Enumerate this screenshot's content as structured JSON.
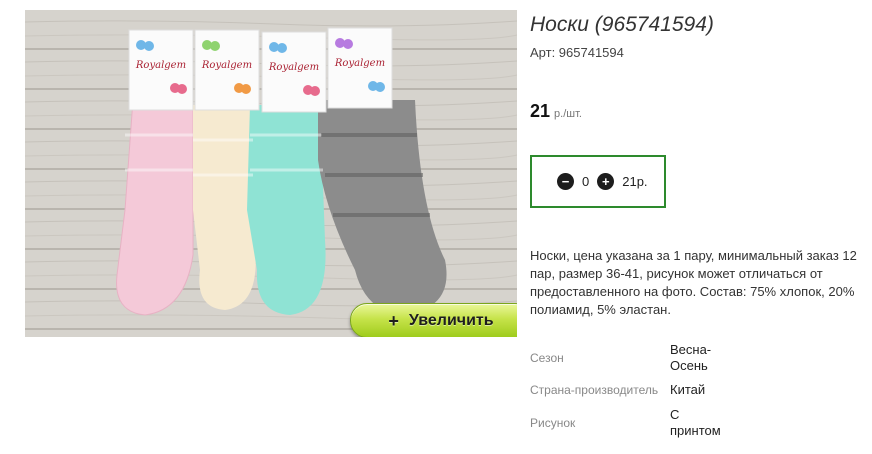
{
  "product": {
    "title": "Носки (965741594)",
    "sku": "Арт: 965741594",
    "price": "21",
    "price_unit": "р./шт.",
    "description": "Носки, цена указана за 1 пару, минимальный заказ 12 пар, размер 36-41, рисунок может отличаться от предоставленного на фото. Состав: 75% хлопок, 20% полиамид, 5% эластан."
  },
  "image": {
    "brand": "Royalgem",
    "zoom_label": "Увеличить",
    "zoom_icon": "+",
    "sock_colors": [
      "#f4c9d8",
      "#f6ead0",
      "#8fe3d4",
      "#8c8c8c"
    ]
  },
  "cart": {
    "minus_icon": "−",
    "plus_icon": "+",
    "quantity": "0",
    "total": "21р."
  },
  "attributes": [
    {
      "key": "Сезон",
      "value": "Весна-Осень"
    },
    {
      "key": "Страна-производитель",
      "value": "Китай"
    },
    {
      "key": "Рисунок",
      "value": "С принтом"
    }
  ],
  "colors": {
    "accent": "#2d8a2d",
    "button": "#b7dd3a"
  }
}
